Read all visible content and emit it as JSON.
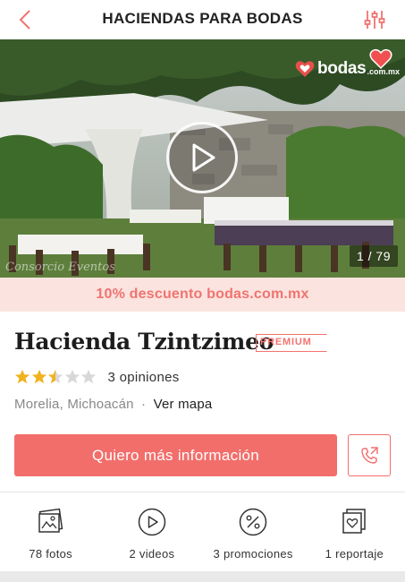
{
  "header": {
    "title": "HACIENDAS PARA BODAS",
    "back_icon": "chevron-left-icon",
    "filter_icon": "sliders-icon"
  },
  "hero": {
    "brand": "bodas",
    "brand_suffix": ".com.mx",
    "counter": "1 / 79",
    "watermark": "Consorcio Eventos",
    "play_icon": "play-icon",
    "favorite_icon": "heart-icon"
  },
  "promo": {
    "text": "10% descuento bodas.com.mx"
  },
  "venue": {
    "name": "Hacienda Tzintzimeo",
    "badge": "PREMIUM",
    "rating": 2.5,
    "rating_max": 5,
    "reviews": "3 opiniones",
    "location": "Morelia, Michoacán",
    "separator": "·",
    "map_link": "Ver mapa"
  },
  "actions": {
    "cta": "Quiero más información",
    "call_icon": "phone-icon"
  },
  "stats": [
    {
      "label": "78 fotos",
      "icon": "photos-icon"
    },
    {
      "label": "2 videos",
      "icon": "video-play-icon"
    },
    {
      "label": "3 promociones",
      "icon": "percent-icon"
    },
    {
      "label": "1 reportaje",
      "icon": "report-icon"
    }
  ],
  "colors": {
    "accent": "#f26e6b",
    "promo_bg": "#fbe3df",
    "star": "#f0b21f",
    "star_empty": "#d8d8d8"
  }
}
